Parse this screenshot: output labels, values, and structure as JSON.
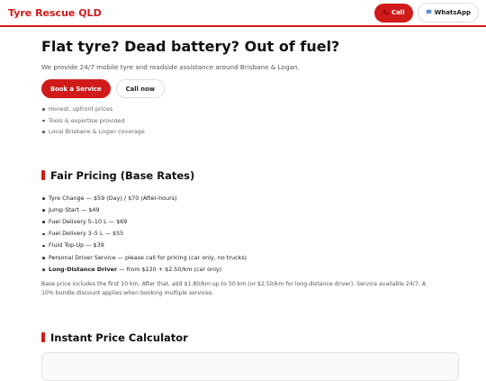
{
  "header": {
    "brand": "Tyre Rescue QLD",
    "call_label": "Call",
    "call_icon": "phone-icon",
    "whatsapp_label": "WhatsApp",
    "whatsapp_icon": "speech-bubble-icon",
    "accent_color": "#d11a1a"
  },
  "hero": {
    "title": "Flat tyre? Dead battery? Out of fuel?",
    "subtitle": "We provide 24/7 mobile tyre and roadside assistance around Brisbane & Logan.",
    "book_label": "Book a Service",
    "call_label": "Call now",
    "features": [
      "Honest, upfront prices",
      "Tools & expertise provided",
      "Local Brisbane & Logan coverage"
    ]
  },
  "pricing": {
    "heading": "Fair Pricing (Base Rates)",
    "items": [
      {
        "text": "Tyre Change — $59 (Day) / $70 (After-hours)"
      },
      {
        "text": "Jump Start — $49"
      },
      {
        "text": "Fuel Delivery 5–10 L — $69"
      },
      {
        "text": "Fuel Delivery 3–5 L — $55"
      },
      {
        "text": "Fluid Top-Up — $39"
      },
      {
        "text": "Personal Driver Service — please call for pricing (car only, no trucks)"
      },
      {
        "bold": "Long-Distance Driver",
        "text": " — from $120 + $2.50/km (car only)"
      }
    ],
    "note": "Base price includes the first 10 km. After that, add $1.80/km up to 50 km (or $2.50/km for long-distance driver). Service available 24/7. A 10% bundle discount applies when booking multiple services."
  },
  "calculator": {
    "heading": "Instant Price Calculator"
  }
}
